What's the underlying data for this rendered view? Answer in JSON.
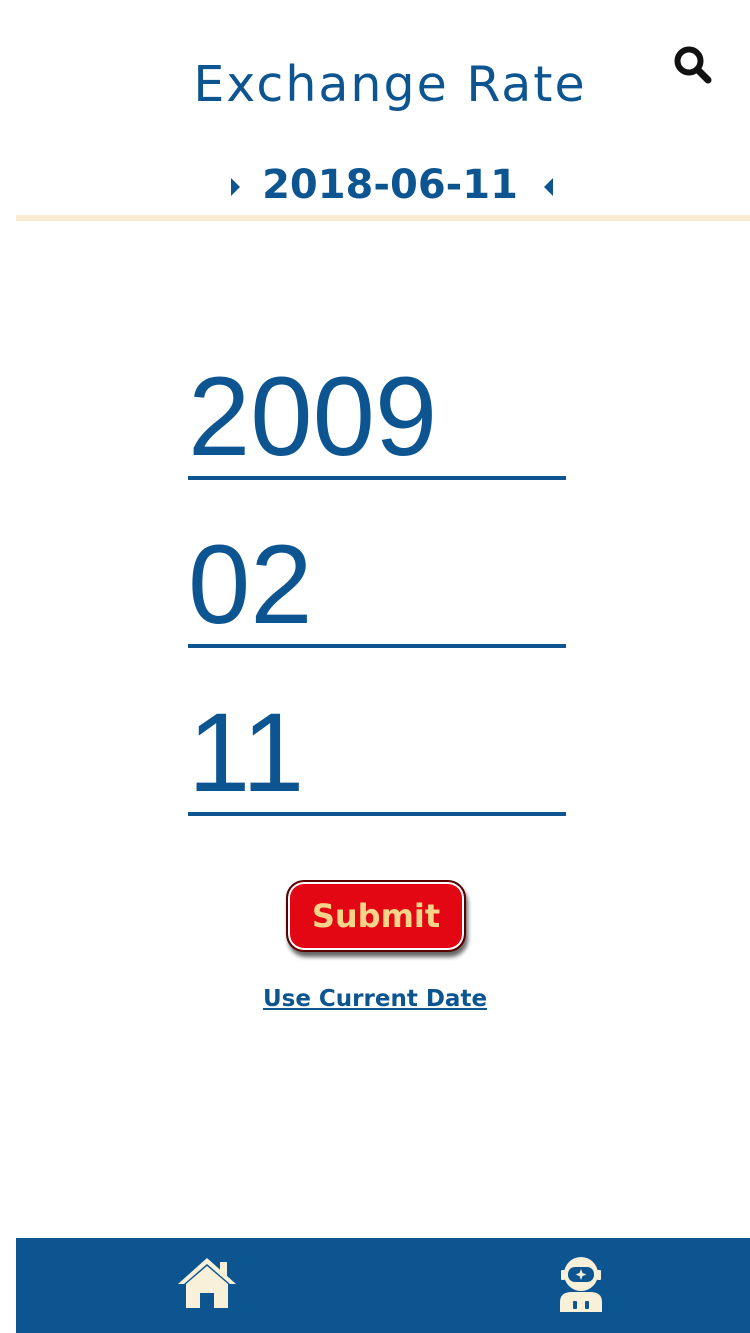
{
  "header": {
    "title": "Exchange Rate",
    "search_icon": "search-icon"
  },
  "date_nav": {
    "current_date": "2018-06-11",
    "next_icon": "caret-right-icon",
    "prev_icon": "caret-left-icon"
  },
  "form": {
    "year_value": "2009",
    "month_value": "02",
    "day_value": "11",
    "submit_label": "Submit",
    "current_date_link": "Use Current Date"
  },
  "bottom_nav": {
    "items": [
      {
        "name": "home",
        "icon": "home-icon"
      },
      {
        "name": "profile",
        "icon": "astronaut-icon"
      }
    ]
  },
  "colors": {
    "primary": "#0d5591",
    "accent": "#e30613",
    "submit_text": "#f6d48a",
    "divider": "#faecd2",
    "icon_cream": "#f8f0d8"
  }
}
